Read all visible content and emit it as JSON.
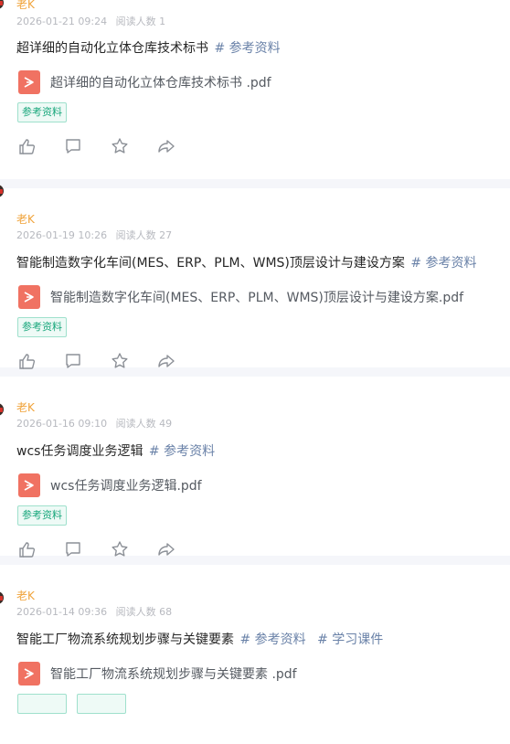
{
  "feed": {
    "posts": [
      {
        "author": "老K",
        "date": "2026-01-21 09:24",
        "reads": "阅读人数 1",
        "title": "超详细的自动化立体仓库技术标书",
        "tags": [
          "# 参考资料"
        ],
        "file_name": "超详细的自动化立体仓库技术标书 .pdf",
        "chip": "参考资料"
      },
      {
        "author": "老K",
        "date": "2026-01-19 10:26",
        "reads": "阅读人数 27",
        "title": "智能制造数字化车间(MES、ERP、PLM、WMS)顶层设计与建设方案",
        "tags": [
          "# 参考资料"
        ],
        "file_name": "智能制造数字化车间(MES、ERP、PLM、WMS)顶层设计与建设方案.pdf",
        "chip": "参考资料"
      },
      {
        "author": "老K",
        "date": "2026-01-16 09:10",
        "reads": "阅读人数 49",
        "title": "wcs任务调度业务逻辑",
        "tags": [
          "# 参考资料"
        ],
        "file_name": "wcs任务调度业务逻辑.pdf",
        "chip": "参考资料"
      },
      {
        "author": "老K",
        "date": "2026-01-14 09:36",
        "reads": "阅读人数 68",
        "title": "智能工厂物流系统规划步骤与关键要素",
        "tags": [
          "# 参考资料",
          "# 学习课件"
        ],
        "file_name": "智能工厂物流系统规划步骤与关键要素 .pdf",
        "chip": ""
      }
    ]
  },
  "icons": [
    "like-icon",
    "comment-icon",
    "star-icon",
    "share-icon",
    "pdf-icon"
  ],
  "colors": {
    "author": "#f0a33a",
    "tag_link": "#6a82a8",
    "chip_text": "#19a77c",
    "pdf": "#f07262",
    "separator": "#f5f6fa"
  }
}
